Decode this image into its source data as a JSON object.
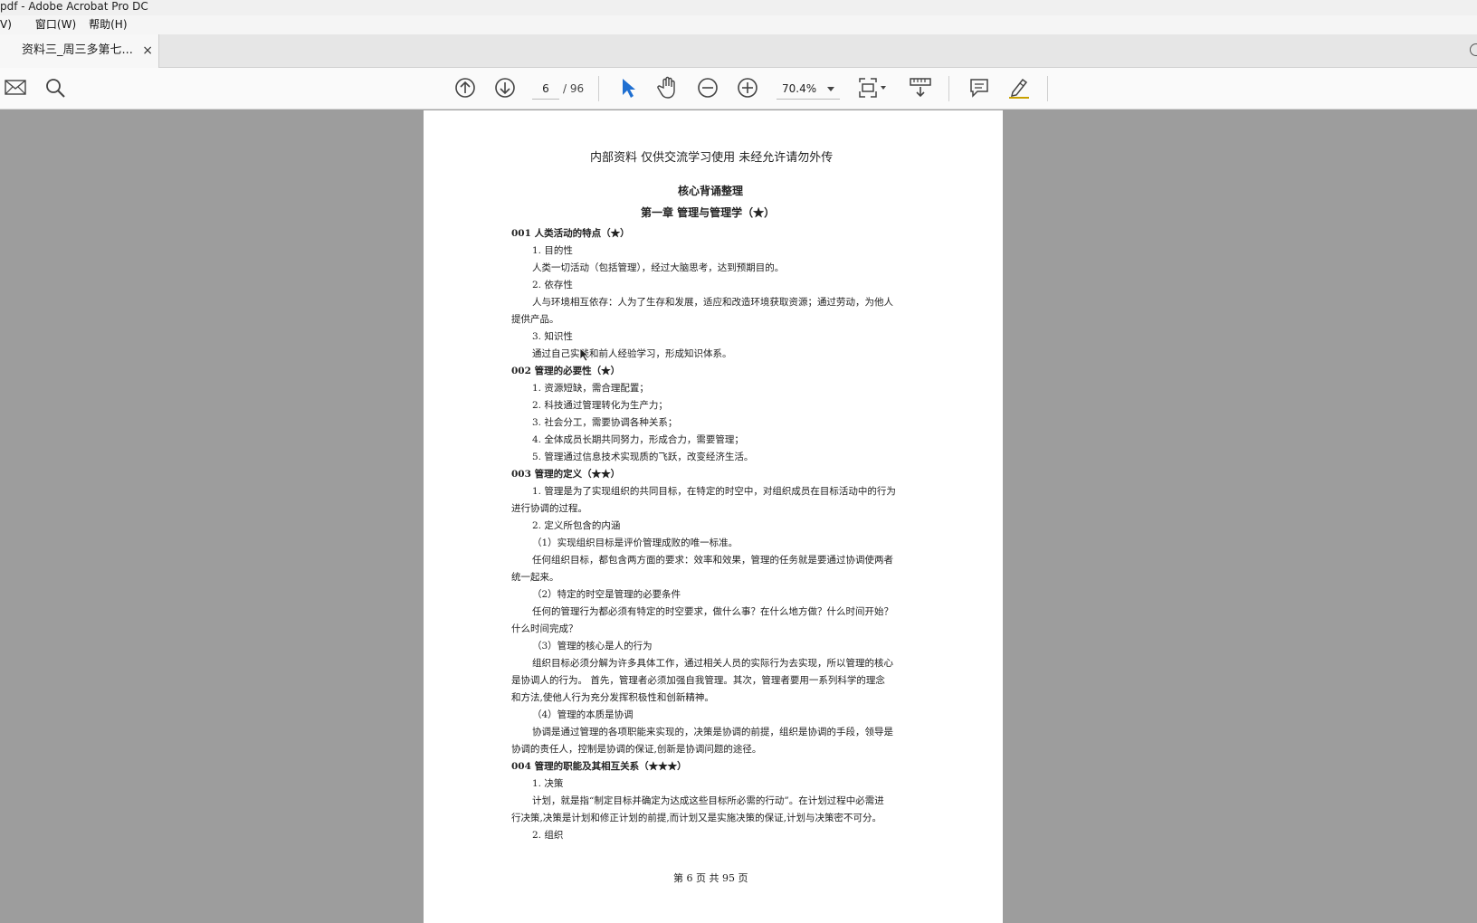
{
  "window": {
    "title": "pdf - Adobe Acrobat Pro DC"
  },
  "menu": [
    "V)",
    "窗口(W)",
    "帮助(H)"
  ],
  "tab": {
    "label": "资料三_周三多第七...",
    "close": "×"
  },
  "toolbar": {
    "current_page": "6",
    "page_total": "/ 96",
    "zoom": "70.4%"
  },
  "document": {
    "header": "内部资料 仅供交流学习使用 未经允许请勿外传",
    "title": "核心背诵整理",
    "chapter": "第一章 管理与管理学（★）",
    "lines": [
      "001 人类活动的特点（★）",
      "1. 目的性",
      "人类一切活动（包括管理），经过大脑思考，达到预期目的。",
      "2. 依存性",
      "人与环境相互依存：人为了生存和发展，适应和改造环境获取资源；通过劳动，为他人",
      "提供产品。",
      "3. 知识性",
      "通过自己实践和前人经验学习，形成知识体系。",
      "002 管理的必要性（★）",
      "1. 资源短缺，需合理配置；",
      "2. 科技通过管理转化为生产力；",
      "3. 社会分工，需要协调各种关系；",
      "4. 全体成员长期共同努力，形成合力，需要管理；",
      "5. 管理通过信息技术实现质的飞跃，改变经济生活。",
      "003 管理的定义（★★）",
      "1. 管理是为了实现组织的共同目标，在特定的时空中，对组织成员在目标活动中的行为",
      "进行协调的过程。",
      "2. 定义所包含的内涵",
      "（1）实现组织目标是评价管理成败的唯一标准。",
      "任何组织目标，都包含两方面的要求：效率和效果，管理的任务就是要通过协调使两者",
      "统一起来。",
      "（2）特定的时空是管理的必要条件",
      "任何的管理行为都必须有特定的时空要求，做什么事？在什么地方做？什么时间开始？",
      "什么时间完成？",
      "（3）管理的核心是人的行为",
      "组织目标必须分解为许多具体工作，通过相关人员的实际行为去实现，所以管理的核心",
      "是协调人的行为。 首先，管理者必须加强自我管理。其次，管理者要用一系列科学的理念",
      "和方法,使他人行为充分发挥积极性和创新精神。",
      "（4）管理的本质是协调",
      "协调是通过管理的各项职能来实现的，决策是协调的前提，组织是协调的手段，领导是",
      "协调的责任人，控制是协调的保证,创新是协调问题的途径。",
      "004 管理的职能及其相互关系（★★★）",
      "1. 决策",
      "计划，就是指“制定目标并确定为达成这些目标所必需的行动”。在计划过程中必需进",
      "行决策,决策是计划和修正计划的前提,而计划又是实施决策的保证,计划与决策密不可分。",
      "2. 组织"
    ],
    "footer": "第 6 页 共 95 页"
  }
}
